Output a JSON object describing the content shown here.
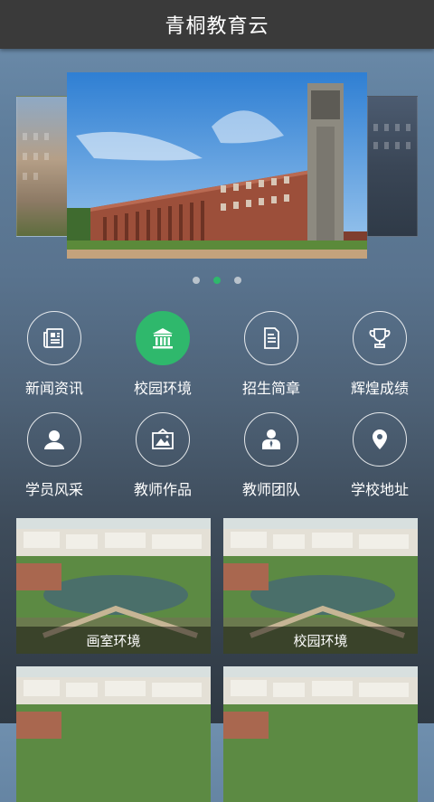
{
  "header": {
    "title": "青桐教育云"
  },
  "carousel": {
    "total_slides": 3,
    "active_index": 1
  },
  "menu": {
    "items": [
      {
        "label": "新闻资讯",
        "icon": "newspaper-icon"
      },
      {
        "label": "校园环境",
        "icon": "campus-building-icon"
      },
      {
        "label": "招生简章",
        "icon": "document-icon"
      },
      {
        "label": "辉煌成绩",
        "icon": "trophy-icon"
      },
      {
        "label": "学员风采",
        "icon": "student-avatar-icon"
      },
      {
        "label": "教师作品",
        "icon": "picture-frame-icon"
      },
      {
        "label": "教师团队",
        "icon": "teacher-icon"
      },
      {
        "label": "学校地址",
        "icon": "location-pin-icon"
      }
    ]
  },
  "gallery": {
    "items": [
      {
        "caption": "画室环境"
      },
      {
        "caption": "校园环境"
      },
      {
        "caption": ""
      },
      {
        "caption": ""
      }
    ]
  },
  "colors": {
    "accent": "#2fb86c",
    "topbar": "#3a3a3a"
  }
}
